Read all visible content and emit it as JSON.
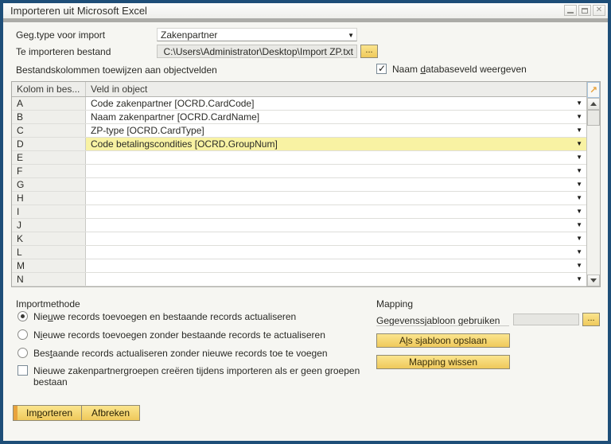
{
  "window": {
    "title": "Importeren uit Microsoft Excel"
  },
  "colors": {
    "window_border": "#1E4E78",
    "accent_gold": "#F3D26C",
    "accent_gold_dark": "#E8A33D",
    "row_highlight": "#F8F2A3",
    "titlebar_strip": "#ACACA8"
  },
  "form": {
    "data_type": {
      "label": "Geg.type voor import",
      "value": "Zakenpartner"
    },
    "file": {
      "label": "Te importeren bestand",
      "value": "C:\\Users\\Administrator\\Desktop\\Import ZP.txt",
      "browse_label": "..."
    },
    "mapping_header_label": "Bestandskolommen toewijzen aan objectvelden",
    "show_db_field": {
      "label": {
        "text": "Naam databaseveld weergeven",
        "u": 5
      },
      "checked": true
    }
  },
  "table": {
    "columns": [
      {
        "label": "Kolom in bes..."
      },
      {
        "label": "Veld in object"
      }
    ],
    "rows": [
      {
        "col": "A",
        "field": "Code zakenpartner [OCRD.CardCode]",
        "highlight": false
      },
      {
        "col": "B",
        "field": "Naam zakenpartner [OCRD.CardName]",
        "highlight": false
      },
      {
        "col": "C",
        "field": "ZP-type [OCRD.CardType]",
        "highlight": false
      },
      {
        "col": "D",
        "field": "Code betalingscondities [OCRD.GroupNum]",
        "highlight": true
      },
      {
        "col": "E",
        "field": "",
        "highlight": false
      },
      {
        "col": "F",
        "field": "",
        "highlight": false
      },
      {
        "col": "G",
        "field": "",
        "highlight": false
      },
      {
        "col": "H",
        "field": "",
        "highlight": false
      },
      {
        "col": "I",
        "field": "",
        "highlight": false
      },
      {
        "col": "J",
        "field": "",
        "highlight": false
      },
      {
        "col": "K",
        "field": "",
        "highlight": false
      },
      {
        "col": "L",
        "field": "",
        "highlight": false
      },
      {
        "col": "M",
        "field": "",
        "highlight": false
      },
      {
        "col": "N",
        "field": "",
        "highlight": false
      }
    ]
  },
  "import_method": {
    "title": "Importmethode",
    "options": [
      {
        "label": {
          "text": "Nieuwe records toevoegen en bestaande records actualiseren",
          "u": 3
        },
        "selected": true
      },
      {
        "label": {
          "text": "Nieuwe records toevoegen zonder bestaande records te actualiseren",
          "u": 1
        },
        "selected": false
      },
      {
        "label": {
          "text": "Bestaande records actualiseren zonder nieuwe records toe te voegen",
          "u": 3
        },
        "selected": false
      }
    ],
    "create_groups": {
      "label": "Nieuwe zakenpartnergroepen creëren tijdens importeren als er geen groepen bestaan",
      "checked": false
    }
  },
  "mapping": {
    "title": "Mapping",
    "template": {
      "label": "Gegevenssjabloon gebruiken",
      "value": "",
      "browse_label": "..."
    },
    "save_button": {
      "text": "Als sjabloon opslaan",
      "u": 1
    },
    "clear_button": "Mapping wissen"
  },
  "footer": {
    "import_button": {
      "text": "Importeren",
      "u": 2
    },
    "cancel_button": "Afbreken"
  }
}
